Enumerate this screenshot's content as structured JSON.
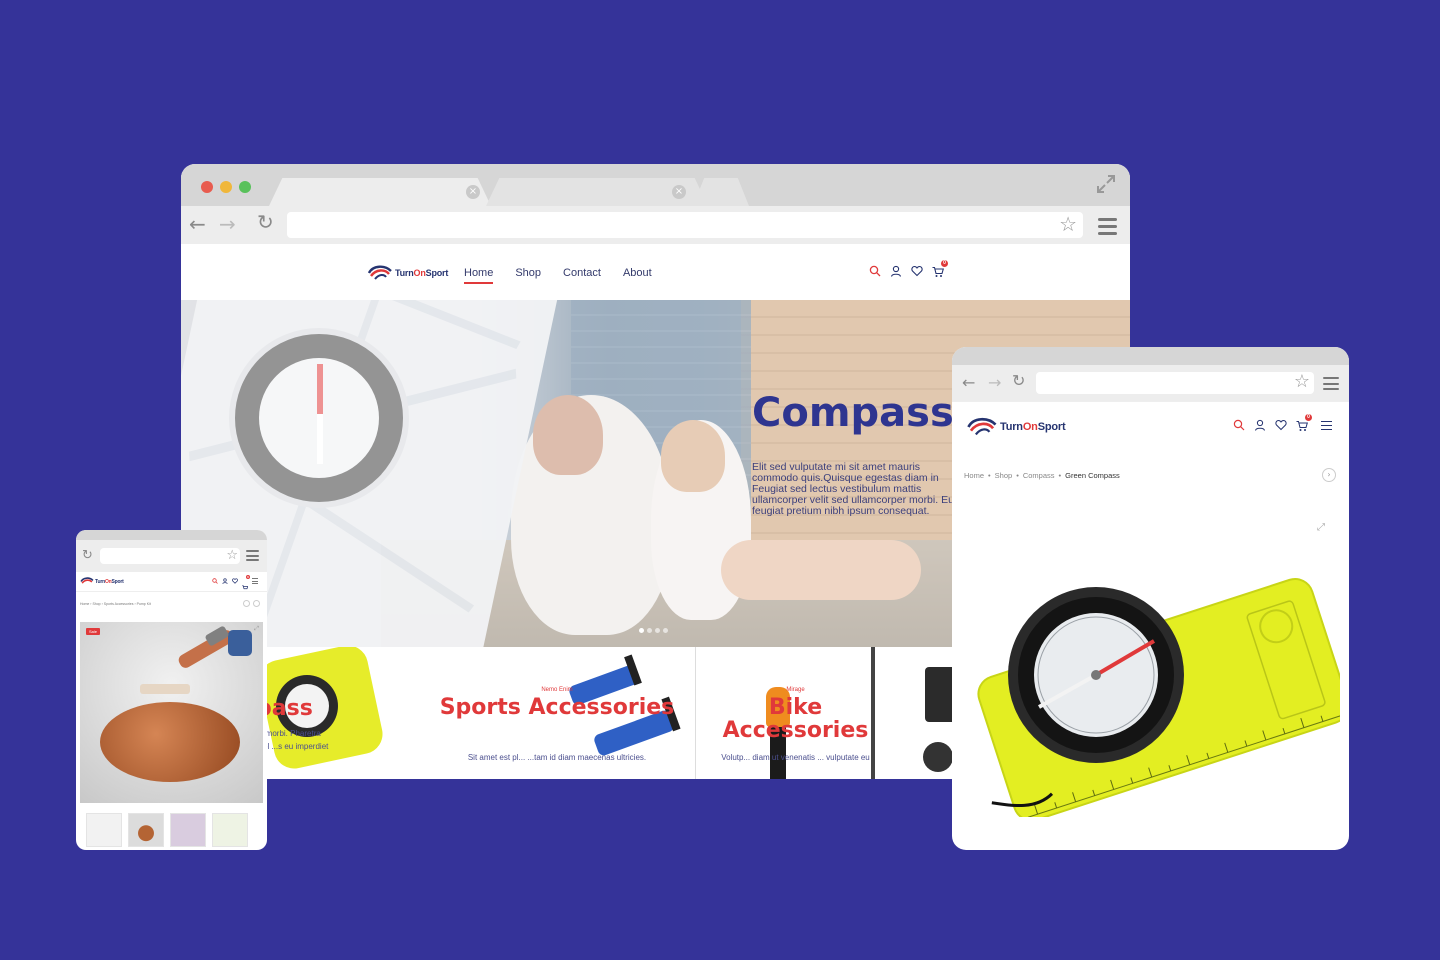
{
  "brand": {
    "name_part1": "Turn",
    "name_part2": "On",
    "name_part3": "Sport",
    "accent": "#e0393a",
    "navy": "#263470",
    "background": "#353399"
  },
  "main_window": {
    "nav": [
      {
        "label": "Home",
        "active": true
      },
      {
        "label": "Shop",
        "active": false
      },
      {
        "label": "Contact",
        "active": false
      },
      {
        "label": "About",
        "active": false
      }
    ],
    "cart_count": "0",
    "hero": {
      "title": "Compass",
      "text": "Elit sed vulputate mi sit amet mauris commodo quis.Quisque egestas diam in Feugiat sed lectus vestibulum mattis ullamcorper velit sed ullamcorper morbi. Eu feugiat pretium nibh ipsum consequat."
    },
    "categories": [
      {
        "title": "pass",
        "sub": "",
        "desc": "...morbi. Pharetra vel ...s eu imperdiet"
      },
      {
        "title": "Sports Accessories",
        "sub": "Nemo Enim",
        "desc": "Sit amet est pl... ...tam id diam maecenas ultricies."
      },
      {
        "title": "Bike Accessories",
        "sub": "Mirage",
        "desc": "Volutp... diam ut venenatis ... vulputate eu"
      },
      {
        "title": "",
        "sub": "",
        "desc": ""
      }
    ]
  },
  "phone_window": {
    "breadcrumb": "Home  ›  Shop  ›  Sports Accessories  ›  Pump Kit",
    "sale_badge": "Sale",
    "cart_count": "0"
  },
  "right_window": {
    "breadcrumb": [
      "Home",
      "Shop",
      "Compass",
      "Green Compass"
    ],
    "cart_count": "0"
  },
  "icons": [
    "search-icon",
    "user-icon",
    "heart-icon",
    "cart-icon",
    "menu-icon",
    "back-icon",
    "forward-icon",
    "reload-icon",
    "star-icon",
    "expand-icon"
  ]
}
